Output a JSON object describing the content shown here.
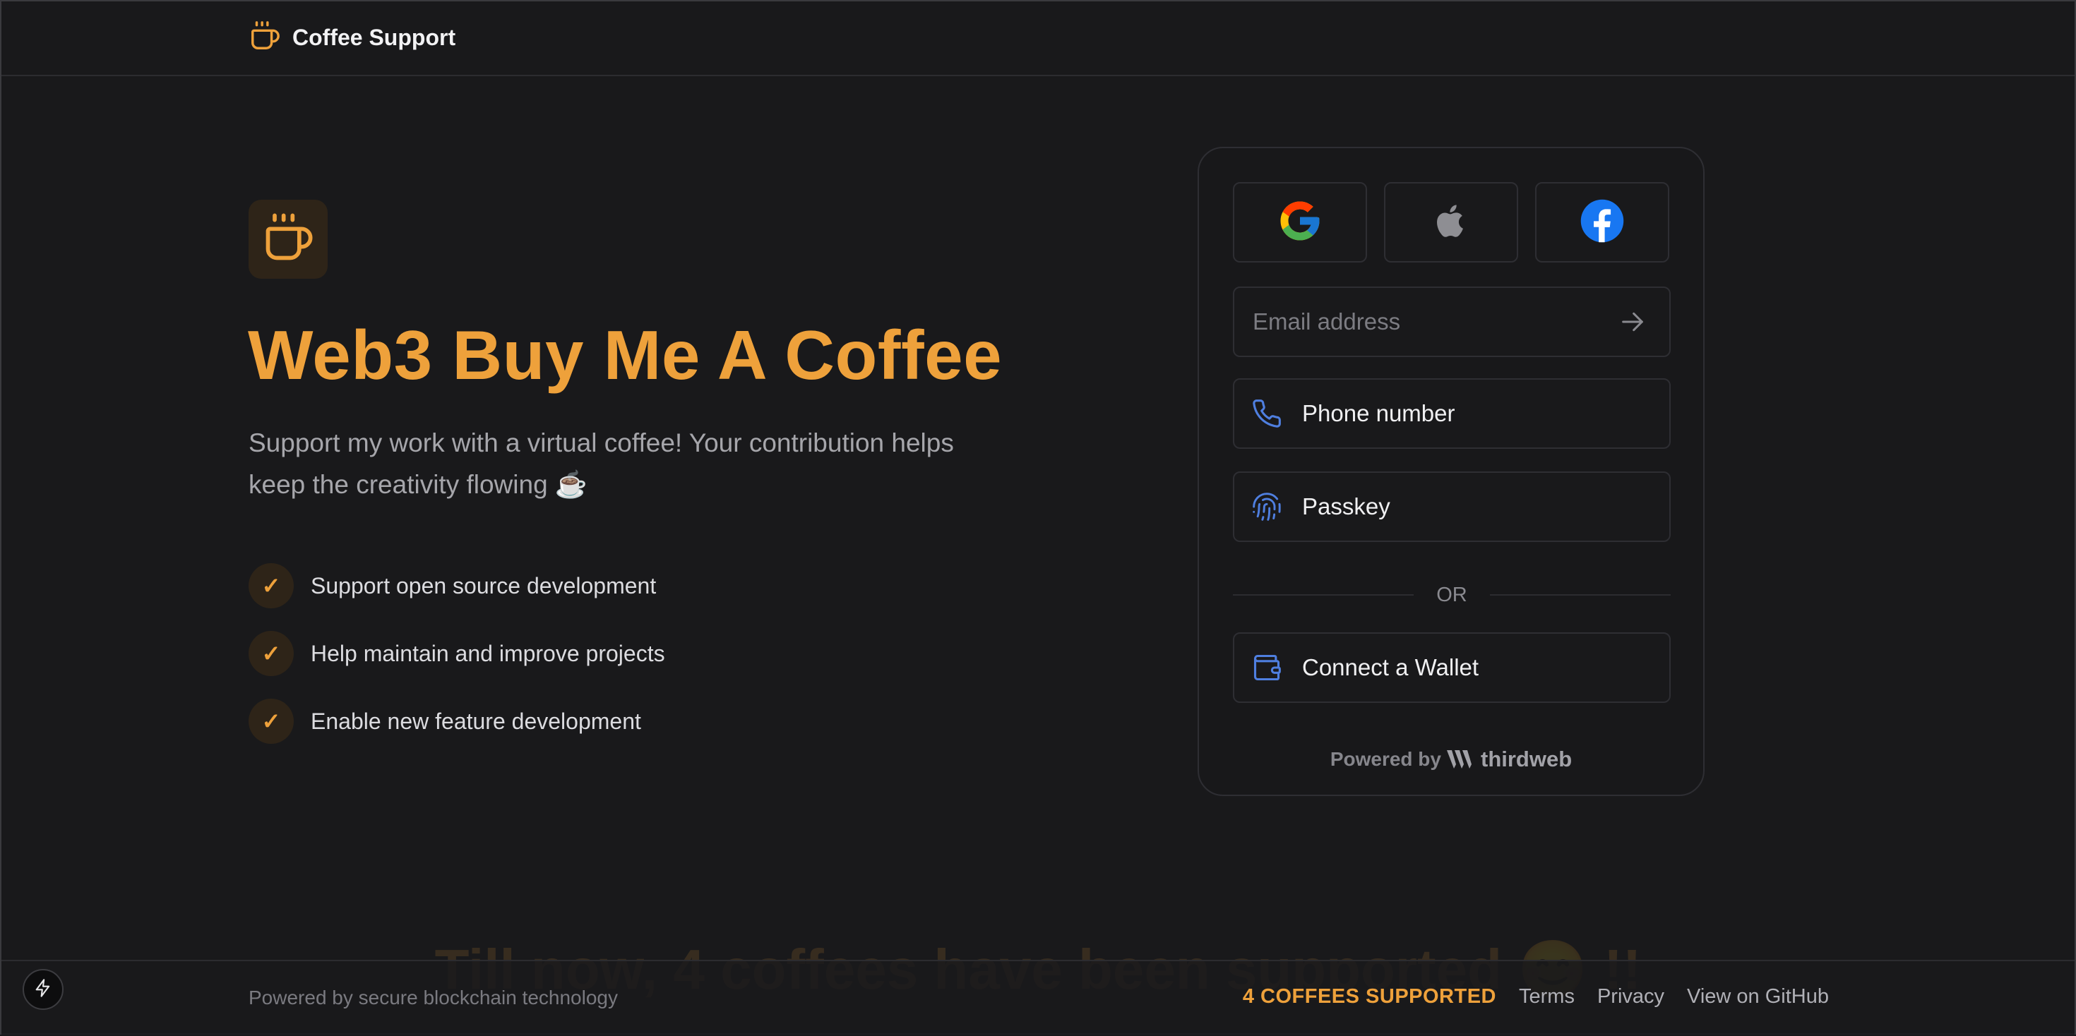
{
  "header": {
    "brand": "Coffee Support",
    "brand_icon": "coffee-cup-icon"
  },
  "hero": {
    "icon": "coffee-cup-icon",
    "title": "Web3 Buy Me A Coffee",
    "subtitle": "Support my work with a virtual coffee! Your contribution helps keep the creativity flowing ☕",
    "features": [
      "Support open source development",
      "Help maintain and improve projects",
      "Enable new feature development"
    ]
  },
  "login": {
    "social": [
      "google-icon",
      "apple-icon",
      "facebook-icon"
    ],
    "email_placeholder": "Email address",
    "phone_label": "Phone number",
    "passkey_label": "Passkey",
    "or_text": "OR",
    "wallet_label": "Connect a Wallet",
    "powered_by": "Powered by",
    "powered_brand": "thirdweb"
  },
  "background_headline": "Till now, 4 coffees have been supported 😊 !!",
  "footer": {
    "left": "Powered by secure blockchain technology",
    "counter": "4 COFFEES SUPPORTED",
    "links": [
      "Terms",
      "Privacy",
      "View on GitHub"
    ]
  },
  "colors": {
    "accent": "#eea13b",
    "background": "#19191b",
    "icon_blue": "#4f7fe0"
  }
}
